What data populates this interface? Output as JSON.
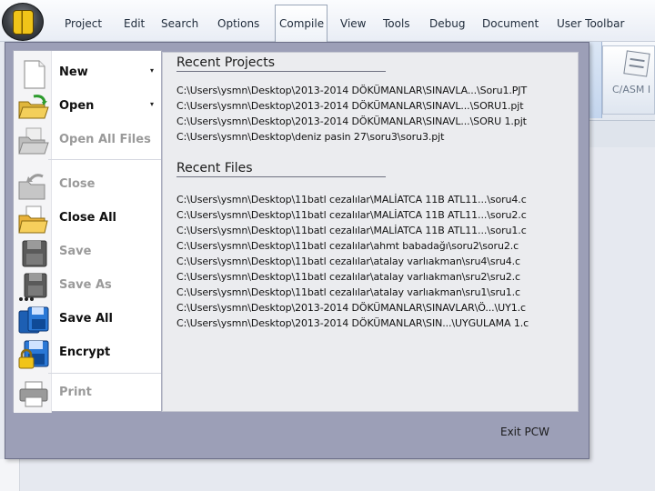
{
  "menubar": {
    "tabs": [
      {
        "label": "Project",
        "x_hint": "project"
      },
      {
        "label": "Edit"
      },
      {
        "label": "Search"
      },
      {
        "label": "Options"
      },
      {
        "label": "Compile"
      },
      {
        "label": "View"
      },
      {
        "label": "Tools"
      },
      {
        "label": "Debug"
      },
      {
        "label": "Document"
      },
      {
        "label": "User Toolbar"
      }
    ]
  },
  "ribbon": {
    "casm_label": "C/ASM I"
  },
  "file_menu": {
    "commands": [
      {
        "label": "New",
        "icon": "new-document-icon",
        "enabled": true,
        "has_submenu": true
      },
      {
        "label": "Open",
        "icon": "open-folder-icon",
        "enabled": true,
        "has_submenu": true
      },
      {
        "label": "Open All Files",
        "icon": "open-all-files-icon",
        "enabled": false,
        "has_submenu": false
      },
      {
        "label": "Close",
        "icon": "close-file-icon",
        "enabled": false,
        "has_submenu": false
      },
      {
        "label": "Close All",
        "icon": "close-all-icon",
        "enabled": true,
        "has_submenu": false
      },
      {
        "label": "Save",
        "icon": "save-icon",
        "enabled": false,
        "has_submenu": false
      },
      {
        "label": "Save As",
        "icon": "save-as-icon",
        "enabled": false,
        "has_submenu": false
      },
      {
        "label": "Save All",
        "icon": "save-all-icon",
        "enabled": true,
        "has_submenu": false
      },
      {
        "label": "Encrypt",
        "icon": "encrypt-icon",
        "enabled": true,
        "has_submenu": false
      },
      {
        "label": "Print",
        "icon": "printer-icon",
        "enabled": false,
        "has_submenu": false
      }
    ],
    "submenu_arrow": "▾",
    "recent_projects_title": "Recent Projects",
    "recent_projects": [
      "C:\\Users\\ysmn\\Desktop\\2013-2014 DÖKÜMANLAR\\SINAVLA...\\Soru1.PJT",
      "C:\\Users\\ysmn\\Desktop\\2013-2014 DÖKÜMANLAR\\SINAVL...\\SORU1.pjt",
      "C:\\Users\\ysmn\\Desktop\\2013-2014 DÖKÜMANLAR\\SINAVL...\\SORU 1.pjt",
      "C:\\Users\\ysmn\\Desktop\\deniz pasin 27\\soru3\\soru3.pjt"
    ],
    "recent_files_title": "Recent Files",
    "recent_files": [
      "C:\\Users\\ysmn\\Desktop\\11batl cezalılar\\MALİATCA 11B ATL11...\\soru4.c",
      "C:\\Users\\ysmn\\Desktop\\11batl cezalılar\\MALİATCA 11B ATL11...\\soru2.c",
      "C:\\Users\\ysmn\\Desktop\\11batl cezalılar\\MALİATCA 11B ATL11...\\soru1.c",
      "C:\\Users\\ysmn\\Desktop\\11batl cezalılar\\ahmt babadağı\\soru2\\soru2.c",
      "C:\\Users\\ysmn\\Desktop\\11batl cezalılar\\atalay varlıakman\\sru4\\sru4.c",
      "C:\\Users\\ysmn\\Desktop\\11batl cezalılar\\atalay varlıakman\\sru2\\sru2.c",
      "C:\\Users\\ysmn\\Desktop\\11batl cezalılar\\atalay varlıakman\\sru1\\sru1.c",
      "C:\\Users\\ysmn\\Desktop\\2013-2014 DÖKÜMANLAR\\SINAVLAR\\Ö...\\UY1.c",
      "C:\\Users\\ysmn\\Desktop\\2013-2014 DÖKÜMANLAR\\SIN...\\UYGULAMA 1.c"
    ],
    "exit_label": "Exit PCW"
  }
}
